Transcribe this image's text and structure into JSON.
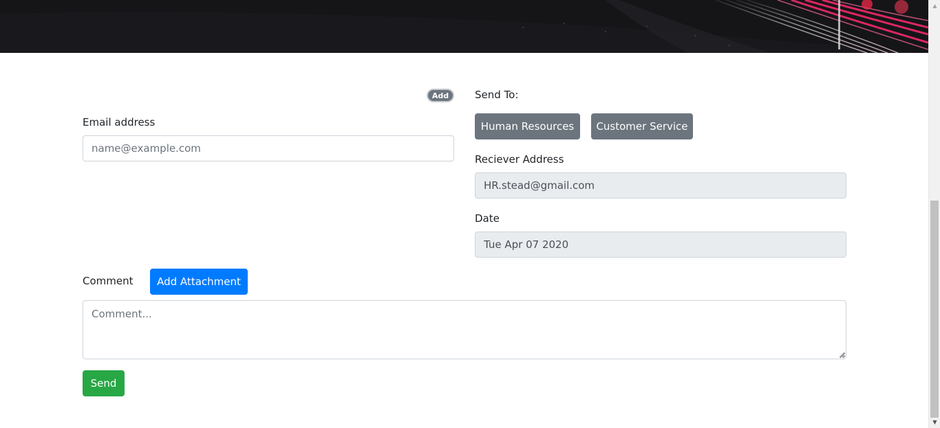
{
  "form": {
    "add_badge": "Add",
    "email_label": "Email address",
    "email_placeholder": "name@example.com",
    "send_to_label": "Send To:",
    "recipient_buttons": [
      "Human Resources",
      "Customer Service"
    ],
    "receiver_label": "Reciever Address",
    "receiver_value": "HR.stead@gmail.com",
    "date_label": "Date",
    "date_value": "Tue Apr 07 2020",
    "comment_label": "Comment",
    "add_attachment_label": "Add Attachment",
    "comment_placeholder": "Comment...",
    "send_label": "Send"
  },
  "colors": {
    "primary": "#007bff",
    "secondary": "#6c757d",
    "success": "#28a745",
    "readonly_bg": "#e9ecef"
  }
}
